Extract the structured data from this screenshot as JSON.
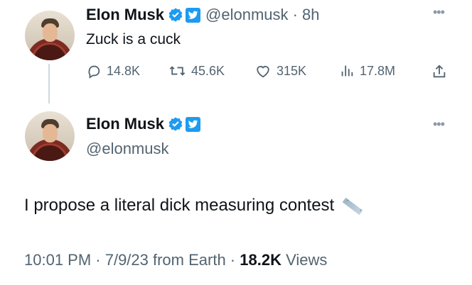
{
  "reply": {
    "display_name": "Elon Musk",
    "handle_time": "@elonmusk · 8h",
    "text": "Zuck is a cuck",
    "actions": [
      {
        "icon": "reply-icon",
        "label": "14.8K"
      },
      {
        "icon": "retweet-icon",
        "label": "45.6K"
      },
      {
        "icon": "like-icon",
        "label": "315K"
      },
      {
        "icon": "views-icon",
        "label": "17.8M"
      },
      {
        "icon": "share-icon",
        "label": ""
      }
    ]
  },
  "tweet": {
    "display_name": "Elon Musk",
    "handle": "@elonmusk",
    "text": "I propose a literal dick measuring contest",
    "timestamp": "10:01 PM · 7/9/23 from Earth · ",
    "views_count": "18.2K",
    "views_label": " Views"
  },
  "colors": {
    "text": "#0f1419",
    "secondary": "#536471",
    "verified": "#1d9bf0",
    "thread_line": "#cfd9de"
  }
}
